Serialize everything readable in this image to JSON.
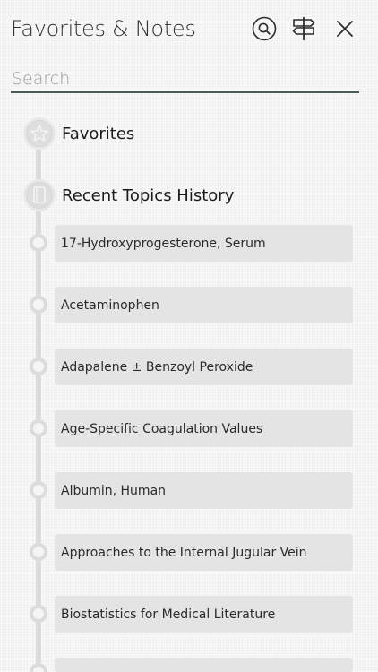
{
  "header": {
    "title": "Favorites & Notes",
    "buttons": [
      {
        "icon": "search-circle-icon"
      },
      {
        "icon": "signpost-icon"
      },
      {
        "icon": "close-icon"
      }
    ]
  },
  "search": {
    "placeholder": "Search",
    "value": ""
  },
  "sections": {
    "favorites": {
      "label": "Favorites",
      "icon": "star-icon"
    },
    "history": {
      "label": "Recent Topics History",
      "icon": "book-icon"
    }
  },
  "history_items": [
    "17-Hydroxyprogesterone, Serum",
    "Acetaminophen",
    "Adapalene ± Benzoyl Peroxide",
    "Age-Specific Coagulation Values",
    "Albumin, Human",
    "Approaches to the Internal Jugular Vein",
    "Biostatistics for Medical Literature"
  ],
  "colors": {
    "accent_underline": "#4a5c5a",
    "item_bg": "#e4e4e4",
    "timeline": "#dcdcdc"
  }
}
